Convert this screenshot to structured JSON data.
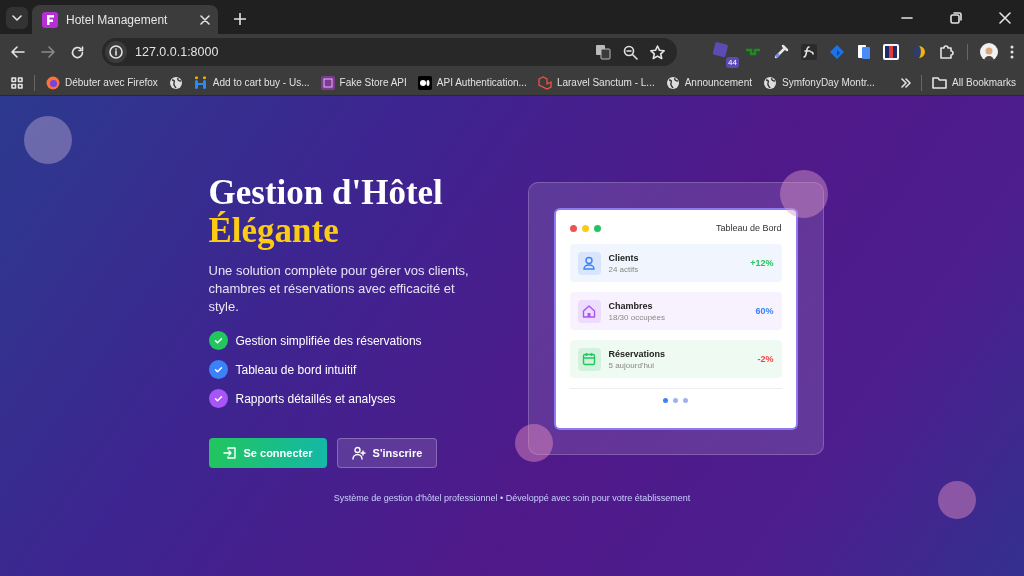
{
  "browser": {
    "tabs": [
      {
        "title": "Hotel Management",
        "selected": true
      }
    ],
    "address": "127.0.0.1:8000",
    "extension_badge": "44",
    "bookmarks": [
      {
        "label": "Débuter avec Firefox",
        "kind": "firefox"
      },
      {
        "kind": "globe"
      },
      {
        "label": "Add to cart buy - Us...",
        "kind": "app"
      },
      {
        "label": "Fake Store API",
        "kind": "store"
      },
      {
        "label": "API Authentication...",
        "kind": "medium"
      },
      {
        "label": "Laravel Sanctum - L...",
        "kind": "laravel"
      },
      {
        "label": "Announcement",
        "kind": "globe"
      },
      {
        "label": "SymfonyDay Montr...",
        "kind": "globe"
      }
    ],
    "all_bookmarks": "All Bookmarks"
  },
  "hero": {
    "title": "Gestion d'Hôtel",
    "title_accent": "Élégante",
    "subtitle": "Une solution complète pour gérer vos clients, chambres et réservations avec efficacité et style.",
    "features": [
      {
        "text": "Gestion simplifiée des réservations",
        "color": "#22c55e"
      },
      {
        "text": "Tableau de bord intuitif",
        "color": "#3b82f6"
      },
      {
        "text": "Rapports détaillés et analyses",
        "color": "#a855f7"
      }
    ],
    "buttons": [
      {
        "label": "Se connecter",
        "kind": "primary"
      },
      {
        "label": "S'inscrire",
        "kind": "secondary"
      }
    ]
  },
  "dashboard": {
    "title": "Tableau de Bord",
    "stats": [
      {
        "label": "Clients",
        "detail": "24 actifs",
        "change": {
          "text": "+12%",
          "color": "#22c55e"
        },
        "kind": "person",
        "color": "#3b82f6"
      },
      {
        "label": "Chambres",
        "detail": "18/30 occupées",
        "change": {
          "text": "60%",
          "color": "#3b82f6"
        },
        "kind": "house",
        "color": "#a855f7"
      },
      {
        "label": "Réservations",
        "detail": "5 aujourd'hui",
        "change": {
          "text": "-2%",
          "color": "#ef4444"
        },
        "kind": "calendar",
        "color": "#22c55e"
      }
    ],
    "pager": [
      {
        "selected": true
      },
      {
        "selected": false
      },
      {
        "selected": false
      }
    ]
  },
  "footer": "Système de gestion d'hôtel professionnel • Développé avec soin pour votre établissement"
}
